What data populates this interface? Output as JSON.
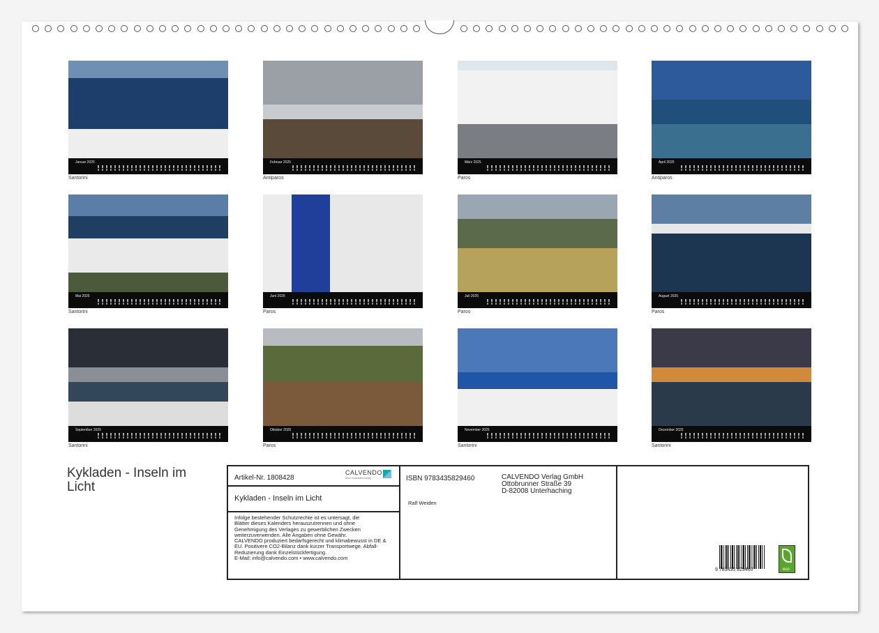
{
  "calendar": {
    "title": "Kykladen - Inseln im Licht",
    "months": [
      {
        "month": "Januar 2025",
        "caption": "Santorini"
      },
      {
        "month": "Februar 2025",
        "caption": "Antiparos"
      },
      {
        "month": "März 2025",
        "caption": "Paros"
      },
      {
        "month": "April 2025",
        "caption": "Antiparos"
      },
      {
        "month": "Mai 2025",
        "caption": "Santorini"
      },
      {
        "month": "Juni 2025",
        "caption": "Paros"
      },
      {
        "month": "Juli 2025",
        "caption": "Paros"
      },
      {
        "month": "August 2025",
        "caption": "Paros"
      },
      {
        "month": "September 2025",
        "caption": "Santorini"
      },
      {
        "month": "Oktober 2025",
        "caption": "Paros"
      },
      {
        "month": "November 2025",
        "caption": "Santorini"
      },
      {
        "month": "Dezember 2025",
        "caption": "Santorini"
      }
    ]
  },
  "info": {
    "article": "Artikel-Nr. 1808428",
    "brand": "CALVENDO",
    "brand_sub": "Mein Kalenderverlag",
    "title": "Kykladen - Inseln im Licht",
    "legal_lines": [
      "Infolge bestehender Schutzrechte ist es untersagt, die",
      "Blätter dieses Kalenders herauszutrennen und ohne",
      "Genehmigung des Verlages zu gewerblichen Zwecken",
      "weiterzuverwenden. Alle Angaben ohne Gewähr.",
      "CALVENDO produziert bedarfsgerecht und klimabewusst in DE &",
      "EU. Positivere CO2-Bilanz dank kurzer Transportwege. Abfall-",
      "Reduzierung dank Einzelstückfertigung.",
      "E-Mail: info@calvendo.com • www.calvendo.com"
    ],
    "isbn": "ISBN 9783435829460",
    "author": "Ralf Weiden",
    "publisher": [
      "CALVENDO Verlag GmbH",
      "Ottobrunner Straße 39",
      "D-82008 Unterhaching"
    ],
    "barcode_number": "9 783435 829460",
    "eco_label": "eco"
  }
}
